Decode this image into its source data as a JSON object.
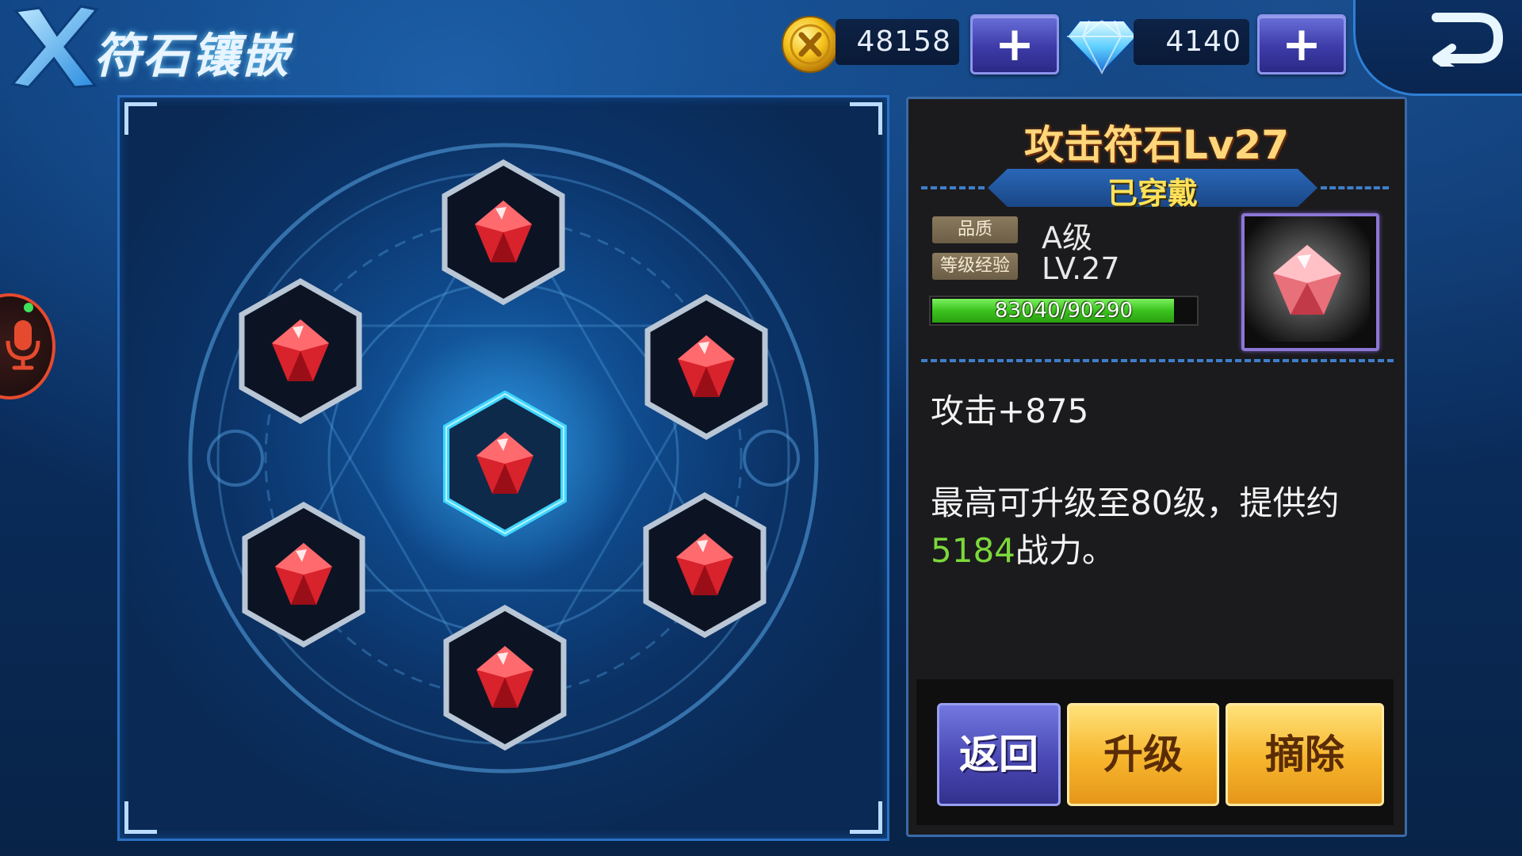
{
  "header": {
    "title": "符石镶嵌",
    "logo_icon": "x-emblem-icon"
  },
  "currencies": {
    "gold": {
      "icon": "gold-coin-icon",
      "value": "48158",
      "add_icon": "plus-icon"
    },
    "diamond": {
      "icon": "diamond-icon",
      "value": "4140",
      "add_icon": "plus-icon"
    }
  },
  "nav": {
    "back_icon": "return-arrow-icon"
  },
  "rune_board": {
    "slots": [
      {
        "slot": "top",
        "icon": "red-rune-gem-icon",
        "selected": false
      },
      {
        "slot": "upper-left",
        "icon": "red-rune-gem-icon",
        "selected": false
      },
      {
        "slot": "upper-right",
        "icon": "red-rune-gem-icon",
        "selected": false
      },
      {
        "slot": "center",
        "icon": "red-rune-gem-icon",
        "selected": true
      },
      {
        "slot": "lower-left",
        "icon": "red-rune-gem-icon",
        "selected": false
      },
      {
        "slot": "lower-right",
        "icon": "red-rune-gem-icon",
        "selected": false
      },
      {
        "slot": "bottom",
        "icon": "red-rune-gem-icon",
        "selected": false
      }
    ]
  },
  "voice": {
    "icon": "microphone-icon"
  },
  "detail": {
    "name": "攻击符石Lv27",
    "status": "已穿戴",
    "quality_label": "品质",
    "quality_value": "A级",
    "level_label": "等级经验",
    "level_value": "LV.27",
    "exp_text": "83040/90290",
    "exp_fraction": 0.92,
    "item_icon": "rune-gem-icon",
    "attack_bonus": "攻击+875",
    "desc_before": "最高可升级至80级，提供约",
    "desc_highlight": "5184",
    "desc_after": "战力。",
    "highlight_color": "#7cd83a"
  },
  "actions": {
    "back_label": "返回",
    "upgrade_label": "升级",
    "remove_label": "摘除"
  }
}
